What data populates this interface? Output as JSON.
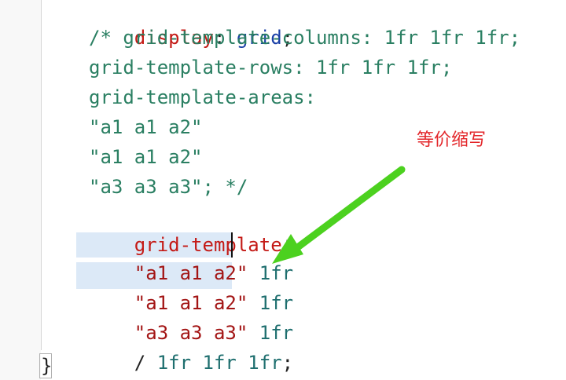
{
  "editor": {
    "lines": [
      {
        "prop": "display",
        "colon": ": ",
        "value": "grid",
        "end": ";"
      },
      {
        "text": "/* grid-template-columns: 1fr 1fr 1fr;"
      },
      {
        "text": "grid-template-rows: 1fr 1fr 1fr;"
      },
      {
        "text": "grid-template-areas:"
      },
      {
        "text": "\"a1 a1 a2\""
      },
      {
        "text": "\"a1 a1 a2\""
      },
      {
        "text": "\"a3 a3 a3\"; */"
      },
      {
        "prop": "grid-template",
        "colon": ":"
      },
      {
        "str": "\"a1 a1 a2\"",
        "num": " 1fr"
      },
      {
        "str": "\"a1 a1 a2\"",
        "num": " 1fr"
      },
      {
        "str": "\"a3 a3 a3\"",
        "num": " 1fr"
      },
      {
        "slash": "/ ",
        "num": "1fr 1fr 1fr",
        "end": ";"
      }
    ],
    "closing_brace": "}"
  },
  "annotation": {
    "text": "等价缩写",
    "color": "#e3262a"
  },
  "arrow": {
    "color": "#4cd11f",
    "icon": "arrow-icon"
  },
  "colors": {
    "property": "#c41a16",
    "keyword": "#1a3fa6",
    "comment": "#2a7f62",
    "string": "#a31515",
    "number": "#1f6f6f",
    "selection": "#dce9f7"
  }
}
